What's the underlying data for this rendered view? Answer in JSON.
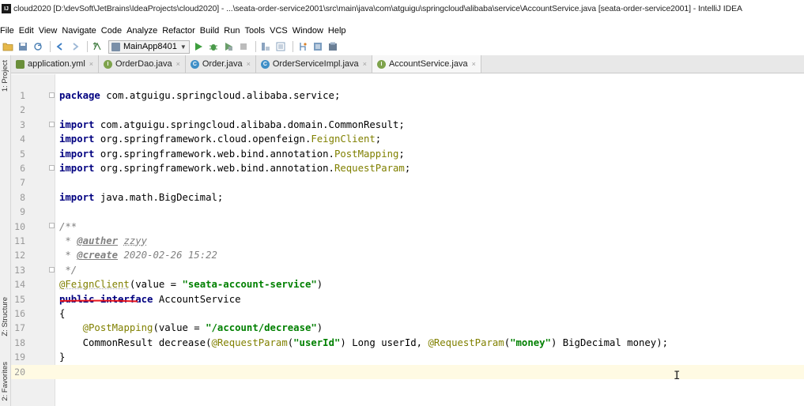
{
  "window": {
    "app_icon_letters": "IJ",
    "title": "cloud2020 [D:\\devSoft\\JetBrains\\IdeaProjects\\cloud2020] - ...\\seata-order-service2001\\src\\main\\java\\com\\atguigu\\springcloud\\alibaba\\service\\AccountService.java [seata-order-service2001] - IntelliJ IDEA"
  },
  "menu": [
    "File",
    "Edit",
    "View",
    "Navigate",
    "Code",
    "Analyze",
    "Refactor",
    "Build",
    "Run",
    "Tools",
    "VCS",
    "Window",
    "Help"
  ],
  "toolbar": {
    "run_config": "MainApp8401",
    "icons": [
      "open-folder-icon",
      "save-icon",
      "sync-icon",
      "back-icon",
      "forward-icon",
      "build-icon",
      "run-icon",
      "debug-icon",
      "coverage-icon",
      "stop-icon",
      "project-structure-icon",
      "sdk-icon",
      "vcs-icon",
      "settings-icon",
      "terminal-icon"
    ]
  },
  "side_tabs": {
    "project": "1: Project",
    "structure": "Z: Structure",
    "favorites": "2: Favorites"
  },
  "tabs": [
    {
      "label": "application.yml",
      "type": "yml",
      "active": false
    },
    {
      "label": "OrderDao.java",
      "type": "interface",
      "active": false
    },
    {
      "label": "Order.java",
      "type": "class",
      "active": false
    },
    {
      "label": "OrderServiceImpl.java",
      "type": "class",
      "active": false
    },
    {
      "label": "AccountService.java",
      "type": "interface",
      "active": true
    }
  ],
  "tab_close_glyph": "×",
  "editor": {
    "line_numbers": [
      "1",
      "2",
      "3",
      "4",
      "5",
      "6",
      "7",
      "8",
      "9",
      "10",
      "11",
      "12",
      "13",
      "14",
      "15",
      "16",
      "17",
      "18",
      "19",
      "20"
    ],
    "current_line": 20,
    "code": {
      "l1_kw": "package",
      "l1_rest": " com.atguigu.springcloud.alibaba.service;",
      "l3_kw": "import",
      "l3_rest": " com.atguigu.springcloud.alibaba.domain.CommonResult;",
      "l4_kw": "import",
      "l4_rest": " org.springframework.cloud.openfeign.",
      "l4_ann": "FeignClient",
      "l4_end": ";",
      "l5_kw": "import",
      "l5_rest": " org.springframework.web.bind.annotation.",
      "l5_ann": "PostMapping",
      "l5_end": ";",
      "l6_kw": "import",
      "l6_rest": " org.springframework.web.bind.annotation.",
      "l6_ann": "RequestParam",
      "l6_end": ";",
      "l8_kw": "import",
      "l8_rest": " java.math.BigDecimal;",
      "l10": "/**",
      "l11_pre": " * ",
      "l11_tag": "@auther",
      "l11_sp": " ",
      "l11_val": "zzyy",
      "l12_pre": " * ",
      "l12_tag": "@create",
      "l12_val": " 2020-02-26 15:22",
      "l13": " */",
      "l14_ann": "@FeignClient",
      "l14_mid": "(value = ",
      "l14_str": "\"seata-account-service\"",
      "l14_end": ")",
      "l15_kw": "public interface",
      "l15_rest": " AccountService",
      "l16": "{",
      "l17_ind": "    ",
      "l17_ann": "@PostMapping",
      "l17_mid": "(value = ",
      "l17_str": "\"/account/decrease\"",
      "l17_end": ")",
      "l18_a": "    CommonResult decrease(",
      "l18_ann1": "@RequestParam",
      "l18_p1": "(",
      "l18_s1": "\"userId\"",
      "l18_b": ") Long userId, ",
      "l18_ann2": "@RequestParam",
      "l18_p2": "(",
      "l18_s2": "\"money\"",
      "l18_c": ") BigDecimal money);",
      "l19": "}"
    }
  },
  "colors": {
    "keyword": "#000080",
    "annotation": "#808000",
    "string": "#008000",
    "comment": "#808080",
    "current_line": "#fffae3",
    "red_marker": "#e8141c"
  }
}
